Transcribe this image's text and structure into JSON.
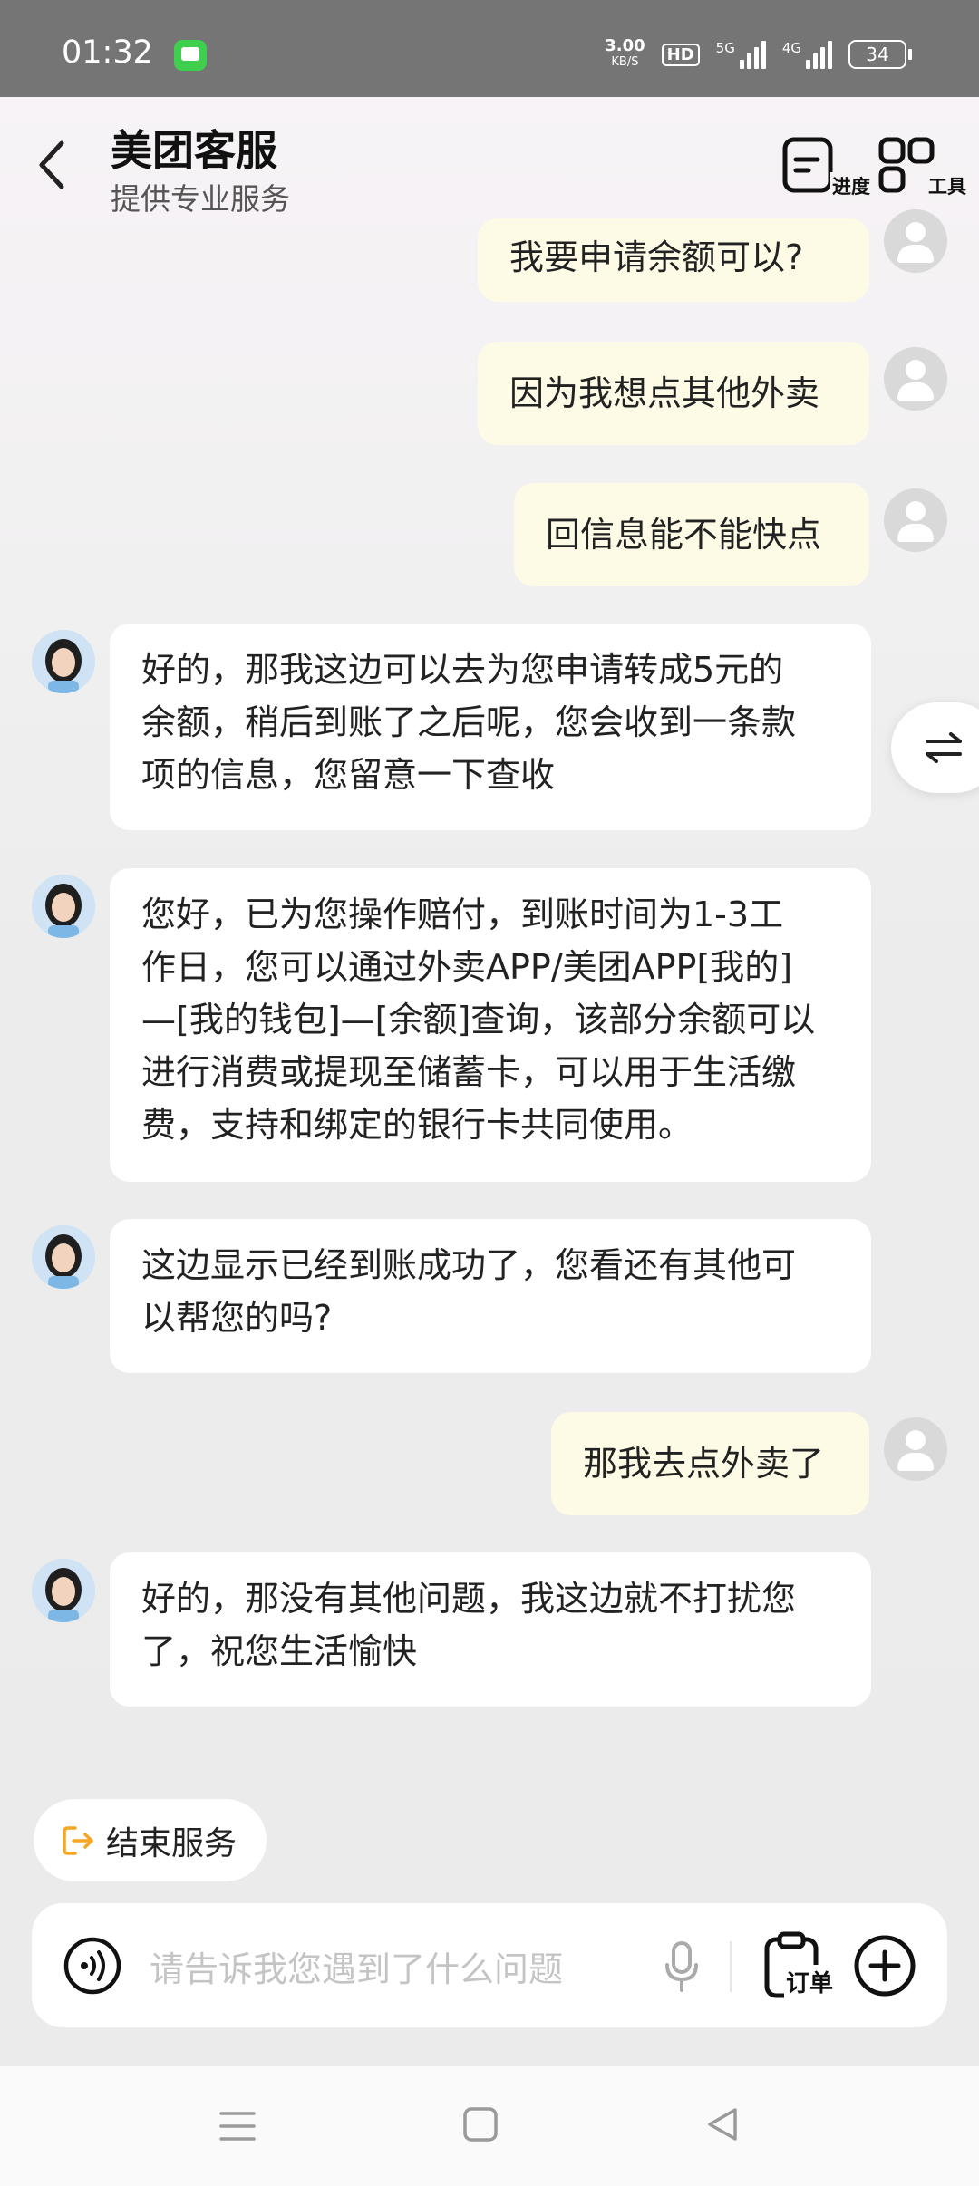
{
  "status_bar": {
    "time": "01:32",
    "net_speed": "3.00",
    "net_speed_unit": "KB/S",
    "hd_label": "HD",
    "signal_1_tag": "5G",
    "signal_2_tag": "4G",
    "battery": "34"
  },
  "header": {
    "title": "美团客服",
    "subtitle": "提供专业服务",
    "progress_label": "进度",
    "tools_label": "工具"
  },
  "messages": [
    {
      "sender": "user",
      "text": "我要申请余额可以?"
    },
    {
      "sender": "user",
      "text": "因为我想点其他外卖"
    },
    {
      "sender": "user",
      "text": "回信息能不能快点"
    },
    {
      "sender": "agent",
      "lines": [
        "好的，那我这边可以去为您申请转成5元的",
        "余额，稍后到账了之后呢，您会收到一条款",
        "项的信息，您留意一下查收"
      ]
    },
    {
      "sender": "agent",
      "lines": [
        "您好，已为您操作赔付，到账时间为1-3工",
        "作日，您可以通过外卖APP/美团APP[我的]",
        "—[我的钱包]—[余额]查询，该部分余额可以",
        "进行消费或提现至储蓄卡，可以用于生活缴",
        "费，支持和绑定的银行卡共同使用。"
      ]
    },
    {
      "sender": "agent",
      "lines": [
        "这边显示已经到账成功了，您看还有其他可",
        "以帮您的吗?"
      ]
    },
    {
      "sender": "user",
      "text": "那我去点外卖了"
    },
    {
      "sender": "agent",
      "lines": [
        "好的，那没有其他问题，我这边就不打扰您",
        "了，祝您生活愉快"
      ]
    }
  ],
  "end_service": {
    "label": "结束服务"
  },
  "input": {
    "placeholder": "请告诉我您遇到了什么问题",
    "order_label": "订单"
  },
  "colors": {
    "user_bubble": "#fdfbe6",
    "agent_bubble": "#ffffff",
    "accent_orange": "#f5a623",
    "status_bar": "#757575"
  }
}
